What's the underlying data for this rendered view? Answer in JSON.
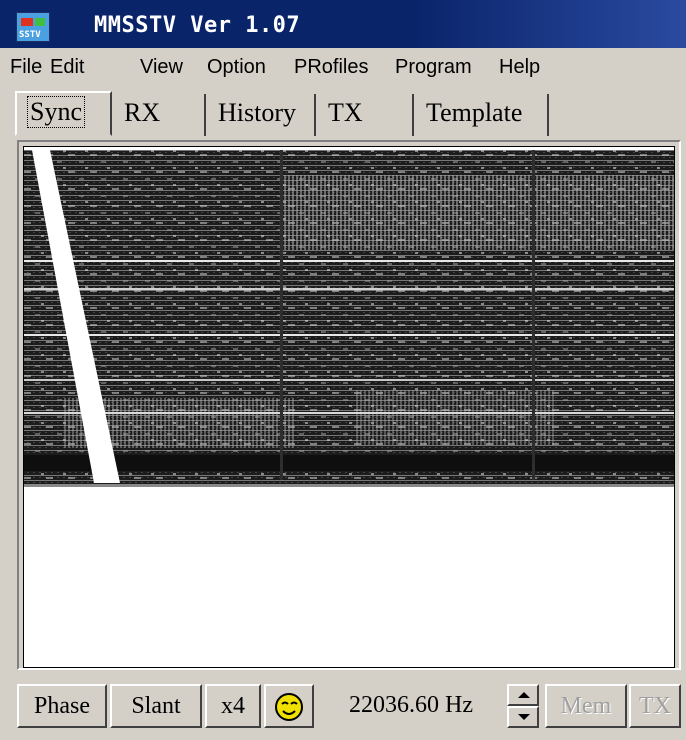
{
  "window": {
    "title": "MMSSTV Ver 1.07",
    "icon_label": "SSTV"
  },
  "menu": [
    "File",
    "Edit",
    "View",
    "Option",
    "PRofiles",
    "Program",
    "Help"
  ],
  "tabs": [
    {
      "label": "Sync",
      "selected": true
    },
    {
      "label": "RX",
      "selected": false
    },
    {
      "label": "History",
      "selected": false
    },
    {
      "label": "TX",
      "selected": false
    },
    {
      "label": "Template",
      "selected": false
    }
  ],
  "sync_panel": {
    "icon": "sync-spectrogram-image"
  },
  "statusbar": {
    "phase_label": "Phase",
    "slant_label": "Slant",
    "zoom_label": "x4",
    "smiley_icon": "smiley-face-icon",
    "frequency": "22036.60 Hz",
    "mem_label": "Mem",
    "tx_label": "TX"
  },
  "colors": {
    "titlebar": "#0a246a",
    "face": "#d4d0c8",
    "smiley": "#f0e000"
  }
}
